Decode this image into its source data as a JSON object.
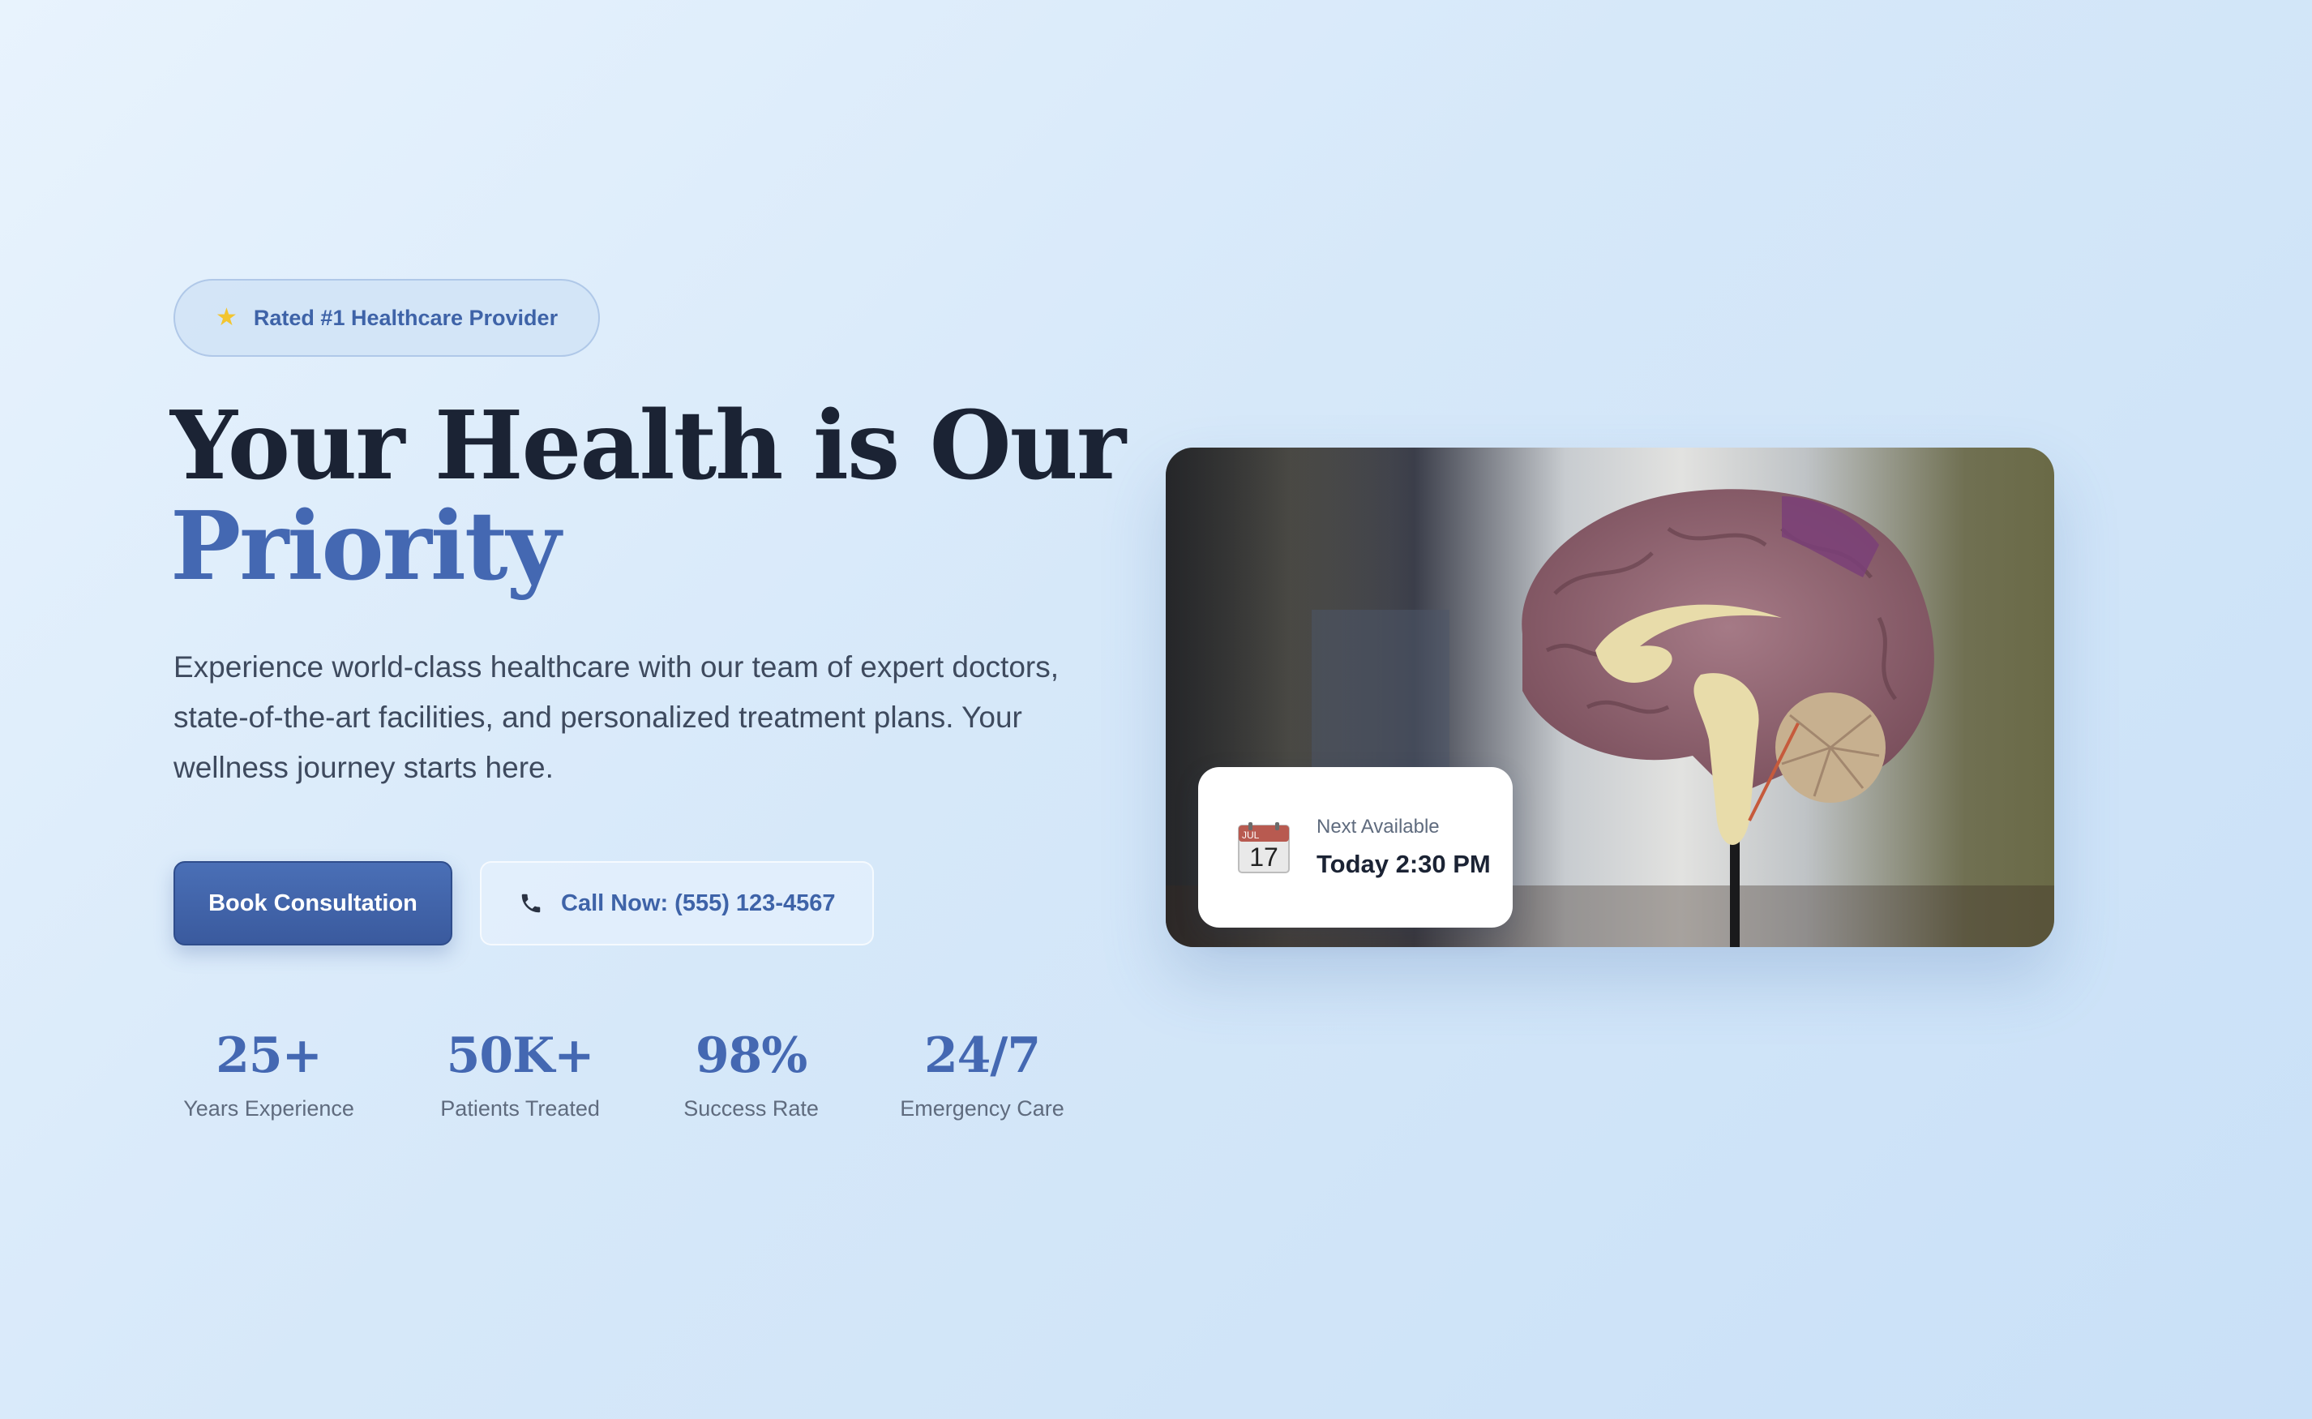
{
  "badge": {
    "icon": "star-icon",
    "text": "Rated #1 Healthcare Provider"
  },
  "hero": {
    "title_line1": "Your Health is Our",
    "title_line2": "Priority",
    "description": "Experience world-class healthcare with our team of expert doctors, state-of-the-art facilities, and personalized treatment plans. Your wellness journey starts here."
  },
  "buttons": {
    "primary_label": "Book Consultation",
    "secondary_icon": "phone-icon",
    "secondary_label": "Call Now: (555) 123-4567"
  },
  "stats": [
    {
      "value": "25+",
      "label": "Years Experience"
    },
    {
      "value": "50K+",
      "label": "Patients Treated"
    },
    {
      "value": "98%",
      "label": "Success Rate"
    },
    {
      "value": "24/7",
      "label": "Emergency Care"
    }
  ],
  "appointment": {
    "icon": "calendar-icon",
    "calendar_month": "JUL",
    "calendar_day": "17",
    "label": "Next Available",
    "time": "Today 2:30 PM"
  },
  "image": {
    "subject": "brain-model-photo"
  },
  "colors": {
    "accent": "#4468b2",
    "heading": "#1b2334",
    "background": "#d6e8f9"
  }
}
